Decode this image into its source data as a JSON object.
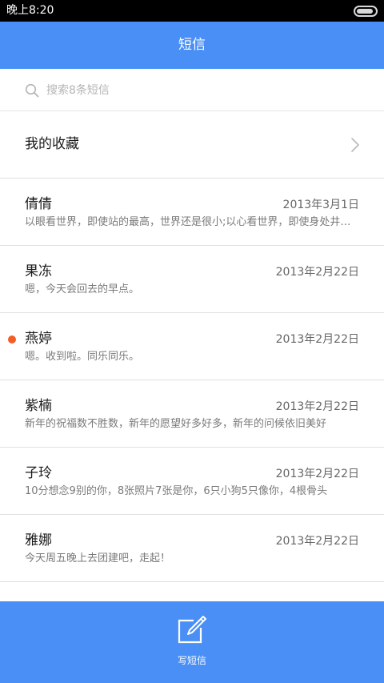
{
  "status_bar": {
    "time": "晚上8:20",
    "battery_level": 0.9
  },
  "header": {
    "title": "短信"
  },
  "search": {
    "placeholder": "搜索8条短信",
    "value": ""
  },
  "favorites": {
    "label": "我的收藏"
  },
  "conversations": [
    {
      "name": "倩倩",
      "date": "2013年3月1日",
      "preview": "以眼看世界，即使站的最高，世界还是很小;以心看世界，即使身处井底，世界也会很大",
      "unread": false
    },
    {
      "name": "果冻",
      "date": "2013年2月22日",
      "preview": "嗯，今天会回去的早点。",
      "unread": false
    },
    {
      "name": "燕婷",
      "date": "2013年2月22日",
      "preview": "嗯。收到啦。同乐同乐。",
      "unread": true
    },
    {
      "name": "紫楠",
      "date": "2013年2月22日",
      "preview": "新年的祝福数不胜数，新年的愿望好多好多，新年的问候依旧美好",
      "unread": false
    },
    {
      "name": "子玲",
      "date": "2013年2月22日",
      "preview": "10分想念9别的你，8张照片7张是你，6只小狗5只像你，4根骨头",
      "unread": false
    },
    {
      "name": "雅娜",
      "date": "2013年2月22日",
      "preview": "今天周五晚上去团建吧，走起！",
      "unread": false
    }
  ],
  "bottom_bar": {
    "compose_label": "写短信"
  },
  "colors": {
    "accent": "#4a8ff5",
    "unread_dot": "#f35d27",
    "status_bar": "#000000"
  },
  "icons": {
    "search": "search-icon",
    "chevron": "chevron-right-icon",
    "compose": "compose-icon",
    "battery": "battery-icon"
  }
}
